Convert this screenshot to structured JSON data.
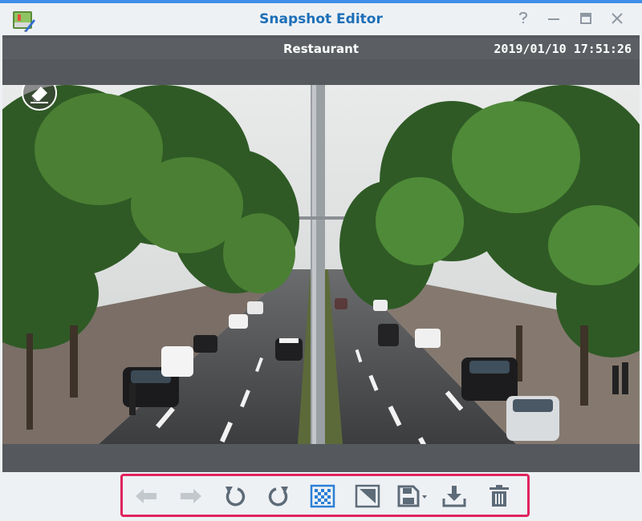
{
  "window": {
    "title": "Snapshot Editor",
    "accent": "#3f8fe8",
    "title_color": "#1d6fb8",
    "controls": [
      {
        "name": "help",
        "glyph": "?"
      },
      {
        "name": "minimize",
        "glyph": "—"
      },
      {
        "name": "maximize",
        "glyph": "▢"
      },
      {
        "name": "close",
        "glyph": "✕"
      }
    ]
  },
  "viewer": {
    "camera_name": "Restaurant",
    "timestamp": "2019/01/10 17:51:26"
  },
  "toolbar": {
    "tools": [
      {
        "icon": "arrow-left-icon",
        "enabled": false
      },
      {
        "icon": "arrow-right-icon",
        "enabled": false
      },
      {
        "icon": "rotate-left-icon",
        "enabled": true
      },
      {
        "icon": "rotate-right-icon",
        "enabled": true
      },
      {
        "icon": "mosaic-icon",
        "enabled": true,
        "active": true
      },
      {
        "icon": "crop-mask-icon",
        "enabled": true
      },
      {
        "icon": "save-icon",
        "enabled": true,
        "has_dropdown": true
      },
      {
        "icon": "download-icon",
        "enabled": true
      },
      {
        "icon": "trash-icon",
        "enabled": true
      }
    ],
    "highlight_color": "#e0245e"
  }
}
